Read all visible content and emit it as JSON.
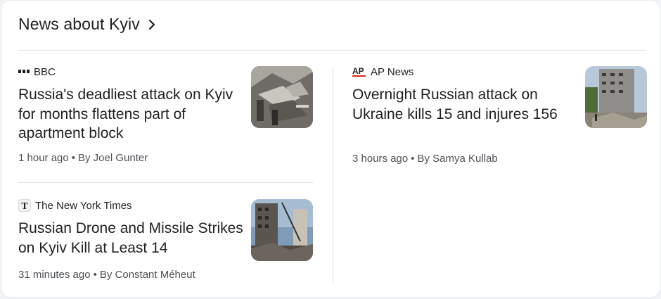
{
  "header": {
    "title": "News about Kyiv",
    "chevron_icon": "chevron-right-icon"
  },
  "articles": [
    {
      "source": "BBC",
      "source_icon": "bbc-logo-icon",
      "headline": "Russia's deadliest attack on Kyiv for months flattens part of apartment block",
      "time": "1 hour ago",
      "separator": "•",
      "author": "By Joel Gunter"
    },
    {
      "source": "The New York Times",
      "source_icon": "nyt-logo-icon",
      "headline": "Russian Drone and Missile Strikes on Kyiv Kill at Least 14",
      "time": "31 minutes ago",
      "separator": "•",
      "author": "By Constant Méheut"
    },
    {
      "source": "AP News",
      "source_icon": "ap-logo-icon",
      "headline": "Overnight Russian attack on Ukraine kills 15 and injures 156",
      "time": "3 hours ago",
      "separator": "•",
      "author": "By Samya Kullab"
    }
  ],
  "colors": {
    "text": "#1f1f1f",
    "meta": "#4d5156",
    "divider": "#e3e3e3",
    "ap_red": "#d9261c"
  }
}
